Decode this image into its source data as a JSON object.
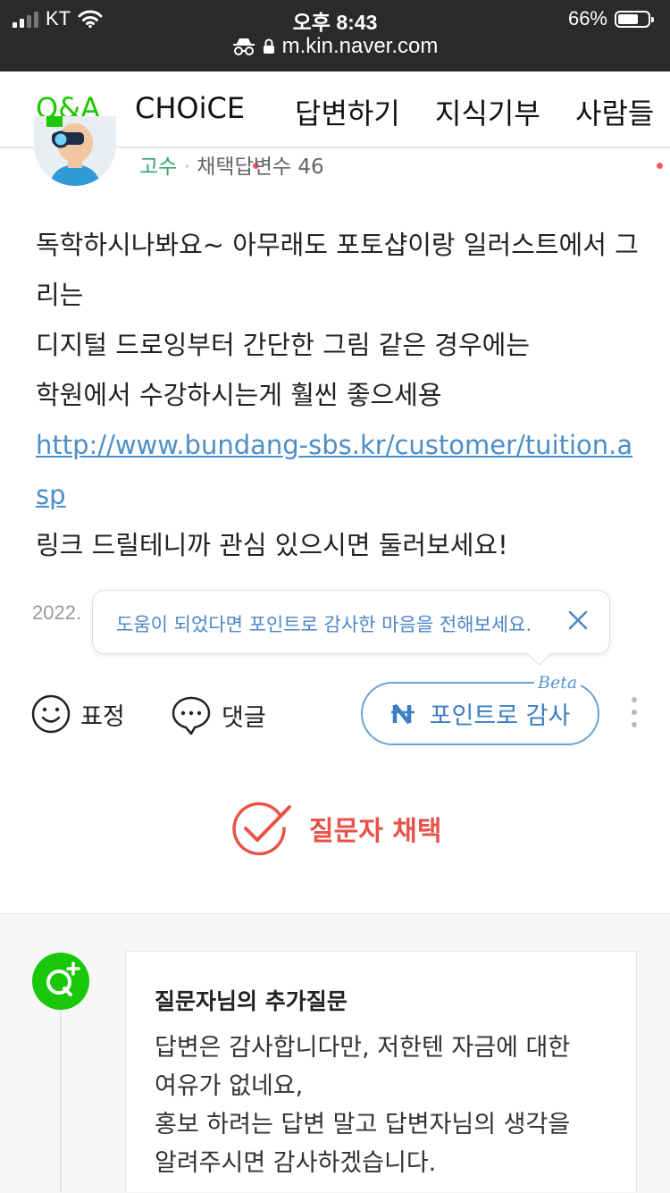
{
  "status_bar": {
    "carrier": "KT",
    "time": "오후 8:43",
    "battery_percent": "66%",
    "battery_level": 0.66,
    "url": "m.kin.naver.com"
  },
  "tabs": [
    {
      "label": "Q&A",
      "active": true
    },
    {
      "label": "CHOiCE",
      "new": true
    },
    {
      "label": "답변하기"
    },
    {
      "label": "지식기부"
    },
    {
      "label": "사람들",
      "new": true
    }
  ],
  "profile": {
    "rank": "고수",
    "separator": "·",
    "adopted_label": "채택답변수 46"
  },
  "answer": {
    "line1": "독학하시나봐요~ 아무래도 포토샵이랑 일러스트에서 그리는",
    "line2": "디지털 드로잉부터 간단한 그림 같은 경우에는",
    "line3": "학원에서 수강하시는게 훨씬 좋으세용",
    "link": "http://www.bundang-sbs.kr/customer/tuition.asp",
    "line4": "링크 드릴테니까 관심 있으시면 둘러보세요!"
  },
  "date": "2022.",
  "tooltip": {
    "text": "도움이 되었다면 포인트로 감사한 마음을 전해보세요."
  },
  "actions": {
    "emotion_label": "표정",
    "comment_label": "댓글",
    "point_label": "포인트로 감사",
    "beta_label": "Beta"
  },
  "select_label": "질문자 채택",
  "extra_question": {
    "title": "질문자님의 추가질문",
    "line1": "답변은 감사합니다만, 저한텐 자금에 대한",
    "line2": "여유가 없네요,",
    "line3": "홍보 하려는 답변 말고 답변자님의 생각을",
    "line4": "알려주시면 감사하겠습니다."
  },
  "colors": {
    "naver_green": "#1ec800",
    "point_blue": "#3d7ec4",
    "select_red": "#e8524a",
    "new_dot": "#ff5a5a"
  }
}
